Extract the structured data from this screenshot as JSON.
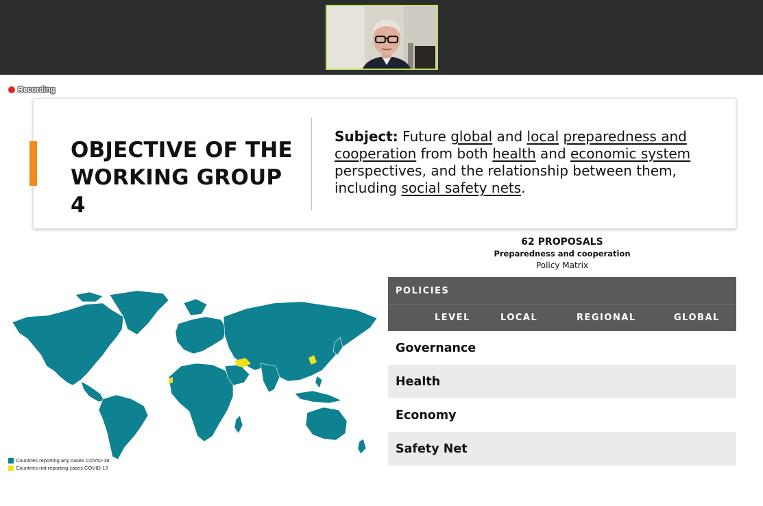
{
  "meeting": {
    "recording_label": "Recording"
  },
  "slide": {
    "objective_title": "OBJECTIVE OF THE WORKING GROUP 4",
    "subject": {
      "label": "Subject:",
      "parts": [
        {
          "text": " Future ",
          "underline": false
        },
        {
          "text": "global",
          "underline": true
        },
        {
          "text": " and ",
          "underline": false
        },
        {
          "text": "local",
          "underline": true
        },
        {
          "text": " ",
          "underline": false
        },
        {
          "text": "preparedness and cooperation",
          "underline": true
        },
        {
          "text": " from both ",
          "underline": false
        },
        {
          "text": "health",
          "underline": true
        },
        {
          "text": " and ",
          "underline": false
        },
        {
          "text": "economic system",
          "underline": true
        },
        {
          "text": " perspectives, and the relationship between them, including ",
          "underline": false
        },
        {
          "text": "social safety nets",
          "underline": true
        },
        {
          "text": ".",
          "underline": false
        }
      ]
    },
    "proposals": {
      "count_label": "62 PROPOSALS",
      "subtitle": "Preparedness and cooperation",
      "caption": "Policy Matrix"
    },
    "matrix": {
      "header": "POLICIES",
      "columns": [
        "LEVEL",
        "LOCAL",
        "REGIONAL",
        "GLOBAL"
      ],
      "rows": [
        "Governance",
        "Health",
        "Economy",
        "Safety Net"
      ]
    },
    "map_legend": {
      "items": [
        {
          "label": "Countries reporting any cases COVID-19",
          "color": "#0e8290"
        },
        {
          "label": "Countries not reporting cases COVID-19",
          "color": "#f2e01e"
        }
      ]
    }
  },
  "colors": {
    "topbar": "#2b2d2e",
    "accent": "#f28a1c",
    "matrix_header": "#595a5c",
    "video_border": "#b9e35a"
  }
}
